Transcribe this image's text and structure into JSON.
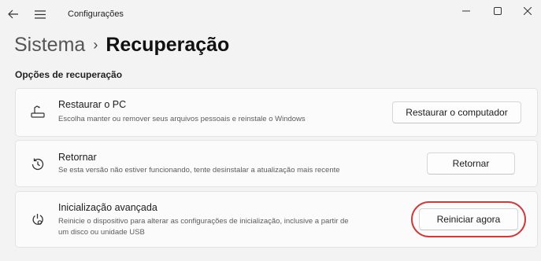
{
  "titlebar": {
    "back_icon": "arrow-left-icon",
    "menu_icon": "hamburger-menu-icon",
    "title": "Configurações",
    "minimize_icon": "minimize-icon",
    "maximize_icon": "maximize-icon",
    "close_icon": "close-icon"
  },
  "breadcrumb": {
    "parent": "Sistema",
    "separator": "›",
    "current": "Recuperação"
  },
  "section": {
    "title": "Opções de recuperação"
  },
  "options": [
    {
      "icon": "restore-pc-icon",
      "title": "Restaurar o PC",
      "description": "Escolha manter ou remover seus arquivos pessoais e reinstale o Windows",
      "button": "Restaurar o computador"
    },
    {
      "icon": "history-restore-icon",
      "title": "Retornar",
      "description": "Se esta versão não estiver funcionando, tente desinstalar a atualização mais recente",
      "button": "Retornar"
    },
    {
      "icon": "advanced-startup-icon",
      "title": "Inicialização avançada",
      "description_line1": "Reinicie o dispositivo para alterar as configurações de inicialização, inclusive a partir de",
      "description_line2": "um disco ou unidade USB",
      "button": "Reiniciar agora",
      "highlight_color": "#cf3a3a"
    }
  ]
}
